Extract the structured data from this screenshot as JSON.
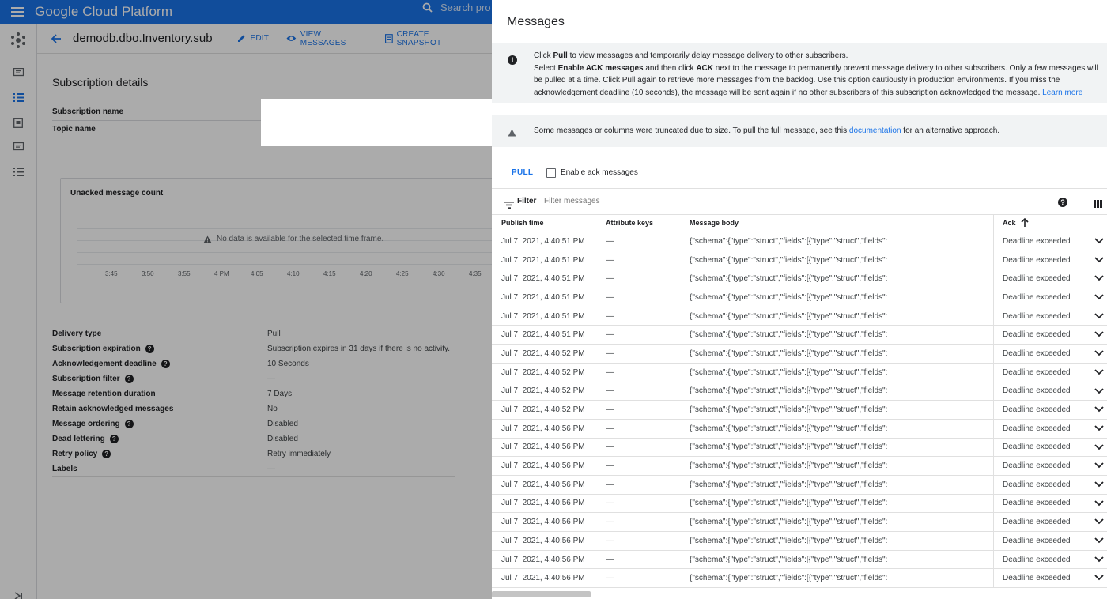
{
  "topbar": {
    "brand": "Google Cloud Platform",
    "search_placeholder": "Search pro"
  },
  "header": {
    "title": "demodb.dbo.Inventory.sub",
    "actions": {
      "edit": "EDIT",
      "view_messages": "VIEW MESSAGES",
      "create_snapshot": "CREATE SNAPSHOT"
    }
  },
  "subscription": {
    "section_title": "Subscription details",
    "name_label": "Subscription name",
    "topic_label": "Topic name"
  },
  "chart_data": {
    "type": "line",
    "title": "Unacked message count",
    "no_data": "No data is available for the selected time frame.",
    "x": [
      "3:45",
      "3:50",
      "3:55",
      "4 PM",
      "4:05",
      "4:10",
      "4:15",
      "4:20",
      "4:25",
      "4:30",
      "4:35"
    ],
    "series": []
  },
  "properties": [
    {
      "label": "Delivery type",
      "value": "Pull",
      "help": false
    },
    {
      "label": "Subscription expiration",
      "value": "Subscription expires in 31 days if there is no activity.",
      "help": true
    },
    {
      "label": "Acknowledgement deadline",
      "value": "10 Seconds",
      "help": true
    },
    {
      "label": "Subscription filter",
      "value": "—",
      "help": true
    },
    {
      "label": "Message retention duration",
      "value": "7 Days",
      "help": false
    },
    {
      "label": "Retain acknowledged messages",
      "value": "No",
      "help": false
    },
    {
      "label": "Message ordering",
      "value": "Disabled",
      "help": true
    },
    {
      "label": "Dead lettering",
      "value": "Disabled",
      "help": true
    },
    {
      "label": "Retry policy",
      "value": "Retry immediately",
      "help": true
    },
    {
      "label": "Labels",
      "value": "—",
      "help": false
    }
  ],
  "panel": {
    "title": "Messages",
    "info": {
      "p1": "Click ",
      "pull": "Pull",
      "p2": " to view messages and temporarily delay message delivery to other subscribers.",
      "p3": "Select ",
      "enable_ack": "Enable ACK messages",
      "p4": " and then click ",
      "ack": "ACK",
      "p5": " next to the message to permanently prevent message delivery to other subscribers. Only a few messages will be pulled at a time. Click Pull again to retrieve more messages from the backlog. Use this option cautiously in production environments. If you miss the acknowledgement deadline (10 seconds), the message will be sent again if no other subscribers of this subscription acknowledged the message.",
      "learn_more": "Learn more"
    },
    "warning": {
      "p1": "Some messages or columns were truncated due to size. To pull the full message, see this ",
      "link": "documentation",
      "p2": " for an alternative approach."
    },
    "pull_button": "PULL",
    "enable_ack_label": "Enable ack messages",
    "filter_label": "Filter",
    "filter_placeholder": "Filter messages",
    "columns": {
      "publish_time": "Publish time",
      "attribute_keys": "Attribute keys",
      "message_body": "Message body",
      "ack": "Ack"
    },
    "rows": [
      {
        "time": "Jul 7, 2021, 4:40:51 PM",
        "keys": "—",
        "body": "{\"schema\":{\"type\":\"struct\",\"fields\":[{\"type\":\"struct\",\"fields\":",
        "ack": "Deadline exceeded"
      },
      {
        "time": "Jul 7, 2021, 4:40:51 PM",
        "keys": "—",
        "body": "{\"schema\":{\"type\":\"struct\",\"fields\":[{\"type\":\"struct\",\"fields\":",
        "ack": "Deadline exceeded"
      },
      {
        "time": "Jul 7, 2021, 4:40:51 PM",
        "keys": "—",
        "body": "{\"schema\":{\"type\":\"struct\",\"fields\":[{\"type\":\"struct\",\"fields\":",
        "ack": "Deadline exceeded"
      },
      {
        "time": "Jul 7, 2021, 4:40:51 PM",
        "keys": "—",
        "body": "{\"schema\":{\"type\":\"struct\",\"fields\":[{\"type\":\"struct\",\"fields\":",
        "ack": "Deadline exceeded"
      },
      {
        "time": "Jul 7, 2021, 4:40:51 PM",
        "keys": "—",
        "body": "{\"schema\":{\"type\":\"struct\",\"fields\":[{\"type\":\"struct\",\"fields\":",
        "ack": "Deadline exceeded"
      },
      {
        "time": "Jul 7, 2021, 4:40:51 PM",
        "keys": "—",
        "body": "{\"schema\":{\"type\":\"struct\",\"fields\":[{\"type\":\"struct\",\"fields\":",
        "ack": "Deadline exceeded"
      },
      {
        "time": "Jul 7, 2021, 4:40:52 PM",
        "keys": "—",
        "body": "{\"schema\":{\"type\":\"struct\",\"fields\":[{\"type\":\"struct\",\"fields\":",
        "ack": "Deadline exceeded"
      },
      {
        "time": "Jul 7, 2021, 4:40:52 PM",
        "keys": "—",
        "body": "{\"schema\":{\"type\":\"struct\",\"fields\":[{\"type\":\"struct\",\"fields\":",
        "ack": "Deadline exceeded"
      },
      {
        "time": "Jul 7, 2021, 4:40:52 PM",
        "keys": "—",
        "body": "{\"schema\":{\"type\":\"struct\",\"fields\":[{\"type\":\"struct\",\"fields\":",
        "ack": "Deadline exceeded"
      },
      {
        "time": "Jul 7, 2021, 4:40:52 PM",
        "keys": "—",
        "body": "{\"schema\":{\"type\":\"struct\",\"fields\":[{\"type\":\"struct\",\"fields\":",
        "ack": "Deadline exceeded"
      },
      {
        "time": "Jul 7, 2021, 4:40:56 PM",
        "keys": "—",
        "body": "{\"schema\":{\"type\":\"struct\",\"fields\":[{\"type\":\"struct\",\"fields\":",
        "ack": "Deadline exceeded"
      },
      {
        "time": "Jul 7, 2021, 4:40:56 PM",
        "keys": "—",
        "body": "{\"schema\":{\"type\":\"struct\",\"fields\":[{\"type\":\"struct\",\"fields\":",
        "ack": "Deadline exceeded"
      },
      {
        "time": "Jul 7, 2021, 4:40:56 PM",
        "keys": "—",
        "body": "{\"schema\":{\"type\":\"struct\",\"fields\":[{\"type\":\"struct\",\"fields\":",
        "ack": "Deadline exceeded"
      },
      {
        "time": "Jul 7, 2021, 4:40:56 PM",
        "keys": "—",
        "body": "{\"schema\":{\"type\":\"struct\",\"fields\":[{\"type\":\"struct\",\"fields\":",
        "ack": "Deadline exceeded"
      },
      {
        "time": "Jul 7, 2021, 4:40:56 PM",
        "keys": "—",
        "body": "{\"schema\":{\"type\":\"struct\",\"fields\":[{\"type\":\"struct\",\"fields\":",
        "ack": "Deadline exceeded"
      },
      {
        "time": "Jul 7, 2021, 4:40:56 PM",
        "keys": "—",
        "body": "{\"schema\":{\"type\":\"struct\",\"fields\":[{\"type\":\"struct\",\"fields\":",
        "ack": "Deadline exceeded"
      },
      {
        "time": "Jul 7, 2021, 4:40:56 PM",
        "keys": "—",
        "body": "{\"schema\":{\"type\":\"struct\",\"fields\":[{\"type\":\"struct\",\"fields\":",
        "ack": "Deadline exceeded"
      },
      {
        "time": "Jul 7, 2021, 4:40:56 PM",
        "keys": "—",
        "body": "{\"schema\":{\"type\":\"struct\",\"fields\":[{\"type\":\"struct\",\"fields\":",
        "ack": "Deadline exceeded"
      },
      {
        "time": "Jul 7, 2021, 4:40:56 PM",
        "keys": "—",
        "body": "{\"schema\":{\"type\":\"struct\",\"fields\":[{\"type\":\"struct\",\"fields\":",
        "ack": "Deadline exceeded"
      }
    ]
  }
}
